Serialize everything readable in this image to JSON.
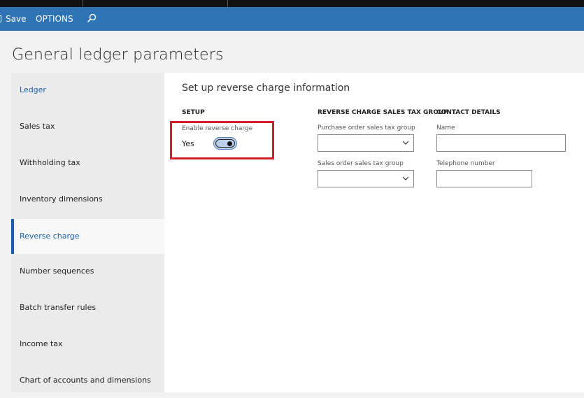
{
  "actionbar": {
    "save_label": "Save",
    "options_label": "OPTIONS",
    "search_icon": "search-icon"
  },
  "page": {
    "title": "General ledger parameters"
  },
  "sidebar": {
    "items": [
      {
        "label": "Ledger",
        "state": "link"
      },
      {
        "label": "Sales tax",
        "state": "normal"
      },
      {
        "label": "Withholding tax",
        "state": "normal"
      },
      {
        "label": "Inventory dimensions",
        "state": "normal"
      },
      {
        "label": "Reverse charge",
        "state": "active"
      },
      {
        "label": "Number sequences",
        "state": "normal"
      },
      {
        "label": "Batch transfer rules",
        "state": "normal"
      },
      {
        "label": "Income tax",
        "state": "normal"
      },
      {
        "label": "Chart of accounts and dimensions",
        "state": "normal"
      }
    ]
  },
  "main": {
    "section_title": "Set up reverse charge information",
    "setup": {
      "header": "SETUP",
      "enable_label": "Enable reverse charge",
      "enable_value": "Yes",
      "enabled": true
    },
    "sales_tax_group": {
      "header": "REVERSE CHARGE SALES TAX GROUP",
      "purchase_label": "Purchase order sales tax group",
      "purchase_value": "",
      "sales_label": "Sales order sales tax group",
      "sales_value": ""
    },
    "contact": {
      "header": "CONTACT DETAILS",
      "name_label": "Name",
      "name_value": "",
      "phone_label": "Telephone number",
      "phone_value": ""
    }
  },
  "colors": {
    "actionbar": "#2e74b5",
    "accent": "#1a5ea8",
    "highlight": "#d0202a"
  }
}
